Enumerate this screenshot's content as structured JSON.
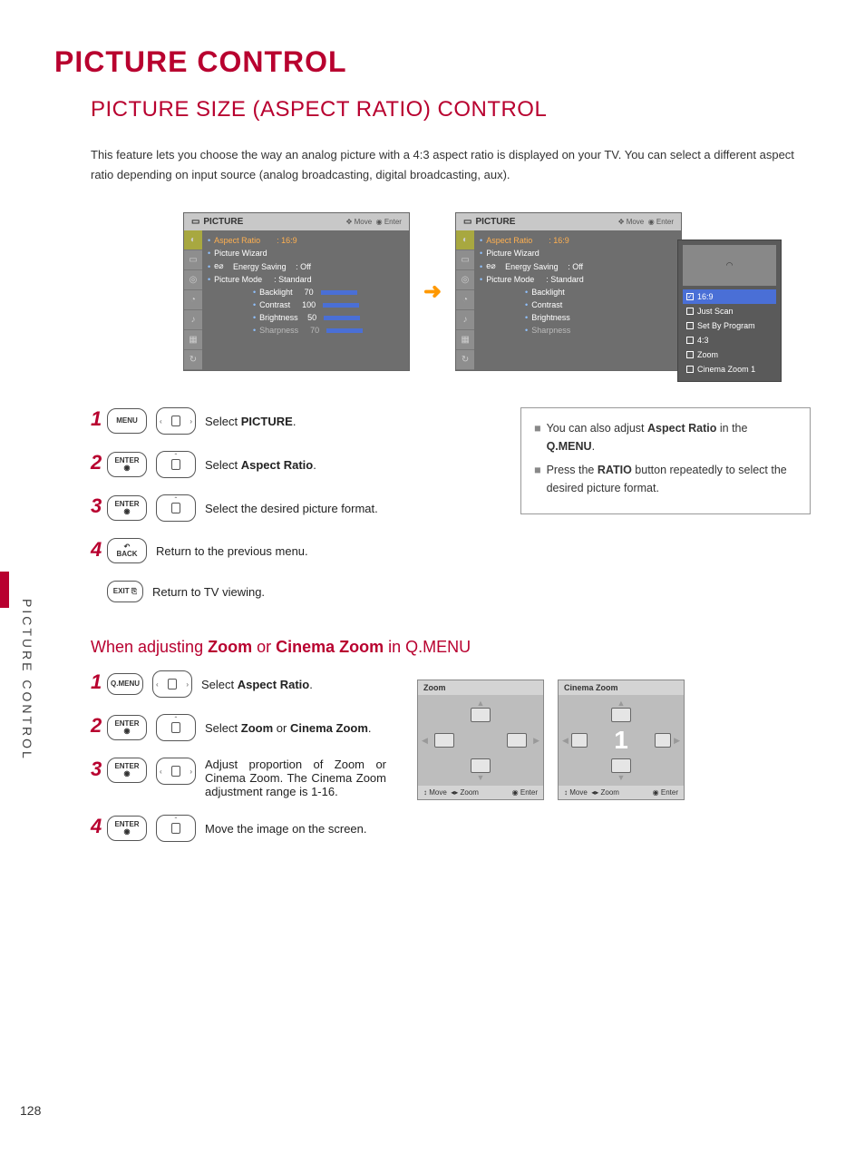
{
  "page_number": "128",
  "side_label": "PICTURE CONTROL",
  "h1": "PICTURE CONTROL",
  "h2": "PICTURE SIZE (ASPECT RATIO) CONTROL",
  "intro": "This feature lets you choose the way an analog picture with a 4:3 aspect ratio is displayed on your TV. You can select a different aspect ratio depending on input source (analog broadcasting, digital broadcasting, aux).",
  "screen": {
    "title": "PICTURE",
    "hint_move": "Move",
    "hint_enter": "Enter",
    "items": {
      "aspect_ratio": "Aspect Ratio",
      "aspect_ratio_val": ": 16:9",
      "picture_wizard": "Picture Wizard",
      "energy_saving": "Energy Saving",
      "energy_saving_val": ": Off",
      "picture_mode": "Picture Mode",
      "picture_mode_val": ": Standard",
      "backlight": "Backlight",
      "backlight_val": "70",
      "contrast": "Contrast",
      "contrast_val": "100",
      "brightness": "Brightness",
      "brightness_val": "50",
      "sharpness": "Sharpness",
      "sharpness_val": "70"
    }
  },
  "dropdown": {
    "o1": "16:9",
    "o2": "Just Scan",
    "o3": "Set By Program",
    "o4": "4:3",
    "o5": "Zoom",
    "o6": "Cinema Zoom 1"
  },
  "buttons": {
    "menu": "MENU",
    "enter": "ENTER",
    "back": "BACK",
    "exit": "EXIT",
    "qmenu": "Q.MENU"
  },
  "steps_a": {
    "s1_pre": "Select ",
    "s1_b": "PICTURE",
    "s1_post": ".",
    "s2_pre": "Select ",
    "s2_b": "Aspect Ratio",
    "s2_post": ".",
    "s3": "Select the desired picture format.",
    "s4": "Return to the previous menu.",
    "s5": "Return to TV viewing."
  },
  "notes": {
    "n1_pre": "You can also adjust ",
    "n1_b1": "Aspect Ratio",
    "n1_mid": " in the ",
    "n1_b2": "Q.MENU",
    "n1_post": ".",
    "n2_pre": "Press the ",
    "n2_b": "RATIO",
    "n2_post": " button repeatedly to select the desired picture format."
  },
  "h3_pre": "When adjusting ",
  "h3_b1": "Zoom",
  "h3_mid": " or ",
  "h3_b2": "Cinema Zoom",
  "h3_post": " in Q.MENU",
  "steps_b": {
    "s1_pre": "Select ",
    "s1_b": "Aspect Ratio",
    "s1_post": ".",
    "s2_pre": "Select ",
    "s2_b1": "Zoom",
    "s2_mid": " or ",
    "s2_b2": "Cinema Zoom",
    "s2_post": ".",
    "s3": "Adjust proportion of Zoom or Cinema Zoom. The Cinema Zoom adjustment range is 1-16.",
    "s4": "Move the image on the screen."
  },
  "zoom": {
    "t1": "Zoom",
    "t2": "Cinema Zoom",
    "cz_val": "1",
    "foot_move": "Move",
    "foot_zoom": "Zoom",
    "foot_enter": "Enter"
  }
}
